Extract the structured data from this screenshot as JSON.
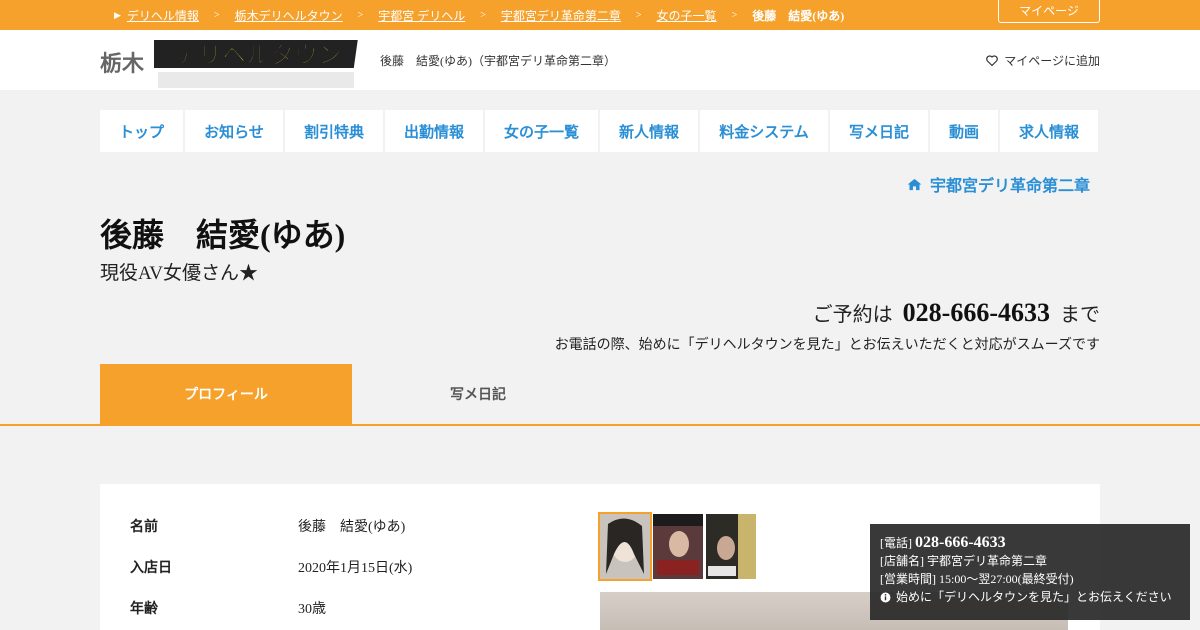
{
  "breadcrumb": {
    "items": [
      "デリヘル情報",
      "栃木デリヘルタウン",
      "宇都宮 デリヘル",
      "宇都宮デリ革命第二章",
      "女の子一覧"
    ],
    "current": "後藤　結愛(ゆあ)",
    "separator": ">",
    "mypage_label": "マイページ"
  },
  "header": {
    "logo_prefix": "栃木",
    "logo_text": "デリヘルタウン",
    "title": "後藤　結愛(ゆあ)（宇都宮デリ革命第二章）",
    "add_mypage_label": "マイページに追加"
  },
  "nav": {
    "items": [
      "トップ",
      "お知らせ",
      "割引特典",
      "出勤情報",
      "女の子一覧",
      "新人情報",
      "料金システム",
      "写メ日記",
      "動画",
      "求人情報"
    ]
  },
  "shop_link": "宇都宮デリ革命第二章",
  "profile": {
    "name": "後藤　結愛(ゆあ)",
    "catchphrase": "現役AV女優さん★"
  },
  "reserve": {
    "prefix": "ご予約は",
    "tel": "028-666-4633",
    "suffix": "まで",
    "note": "お電話の際、始めに「デリヘルタウンを見た」とお伝えいただくと対応がスムーズです"
  },
  "tabs": [
    "プロフィール",
    "写メ日記"
  ],
  "details": [
    {
      "label": "名前",
      "value": "後藤　結愛(ゆあ)"
    },
    {
      "label": "入店日",
      "value": "2020年1月15日(水)"
    },
    {
      "label": "年齢",
      "value": "30歳"
    }
  ],
  "infobox": {
    "tel_label": "[電話]",
    "tel": "028-666-4633",
    "shop_label": "[店舗名]",
    "shop": "宇都宮デリ革命第二章",
    "hours_label": "[営業時間]",
    "hours": "15:00～翌27:00(最終受付)",
    "note": "始めに「デリヘルタウンを見た」とお伝えください"
  },
  "colors": {
    "accent": "#f6a12b",
    "link": "#2b8fd6",
    "background": "#f2f2f2"
  }
}
